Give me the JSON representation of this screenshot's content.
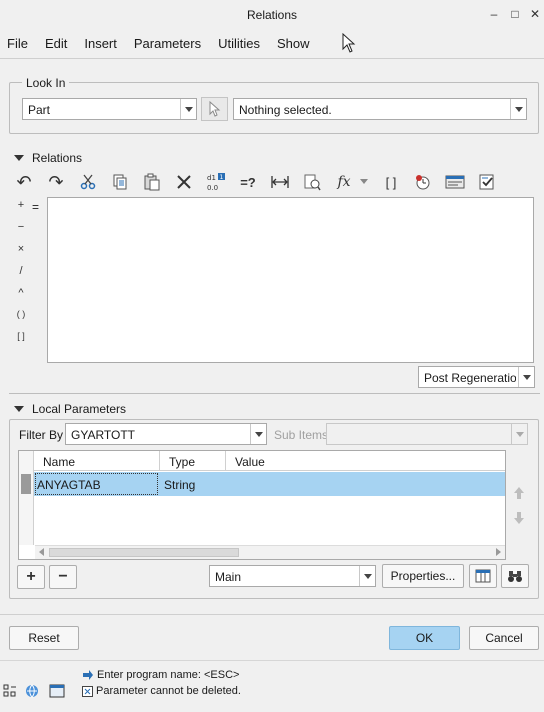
{
  "window": {
    "title": "Relations",
    "minimize_glyph": "–",
    "maximize_glyph": "□",
    "close_glyph": "✕"
  },
  "menu": [
    "File",
    "Edit",
    "Insert",
    "Parameters",
    "Utilities",
    "Show"
  ],
  "look_in": {
    "label": "Look In",
    "type_value": "Part",
    "selection_value": "Nothing selected."
  },
  "relations": {
    "label": "Relations",
    "equals_sign": "=",
    "operators": [
      "+",
      "−",
      "×",
      "/",
      "^",
      "( )",
      "[ ]"
    ],
    "toolbar_glyphs": {
      "undo": "↶",
      "redo": "↷",
      "evaluate": "=?",
      "function": "fx",
      "brackets": "[ ]"
    },
    "regen_value": "Post Regeneration"
  },
  "local_parameters": {
    "label": "Local Parameters",
    "filter_label": "Filter By",
    "filter_value": "GYARTOTT",
    "sub_items_label": "Sub Items",
    "columns": [
      "Name",
      "Type",
      "Value"
    ],
    "rows": [
      {
        "name": "ANYAGTAB",
        "type": "String",
        "value": ""
      }
    ],
    "view_value": "Main",
    "properties_label": "Properties...",
    "add_glyph": "+",
    "remove_glyph": "−"
  },
  "footer": {
    "reset_label": "Reset",
    "ok_label": "OK",
    "cancel_label": "Cancel"
  },
  "status": {
    "message_1": "Enter program name:  <ESC>",
    "message_2": "Parameter  cannot be deleted."
  },
  "colors": {
    "accent": "#a6d3f2",
    "window_bg": "#f0f0f0"
  }
}
